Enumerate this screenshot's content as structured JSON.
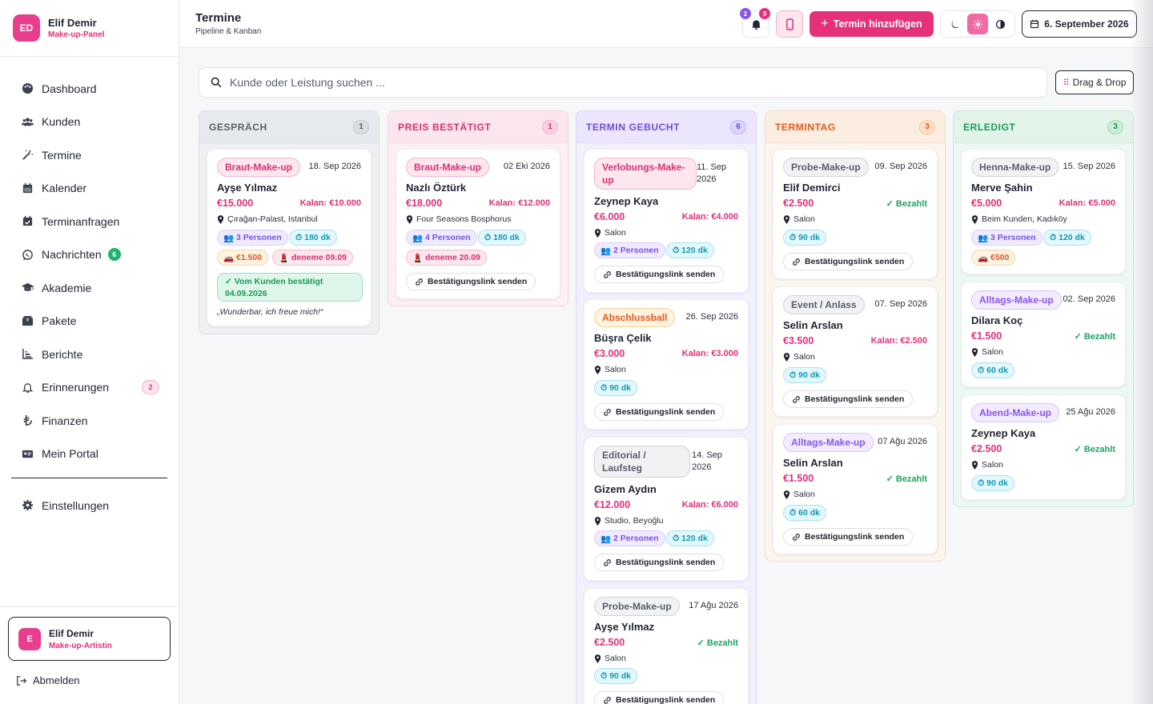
{
  "brand": {
    "initials": "ED",
    "name": "Elif Demir",
    "role": "Make-up-Panel"
  },
  "nav": [
    {
      "label": "Dashboard",
      "icon": "palette-icon"
    },
    {
      "label": "Kunden",
      "icon": "users-icon"
    },
    {
      "label": "Termine",
      "icon": "wand-icon"
    },
    {
      "label": "Kalender",
      "icon": "calendar-icon"
    },
    {
      "label": "Terminanfragen",
      "icon": "calendar-check-icon"
    },
    {
      "label": "Nachrichten",
      "icon": "whatsapp-icon",
      "badge": "6"
    },
    {
      "label": "Akademie",
      "icon": "graduation-cap-icon"
    },
    {
      "label": "Pakete",
      "icon": "box-icon"
    },
    {
      "label": "Berichte",
      "icon": "chart-icon"
    },
    {
      "label": "Erinnerungen",
      "icon": "bell-icon",
      "badge": "2"
    },
    {
      "label": "Finanzen",
      "icon": "lira-icon"
    },
    {
      "label": "Mein Portal",
      "icon": "id-card-icon"
    }
  ],
  "settings_label": "Einstellungen",
  "user": {
    "initial": "E",
    "name": "Elif Demir",
    "role": "Make-up-Artistin"
  },
  "logout_label": "Abmelden",
  "header": {
    "title": "Termine",
    "subtitle": "Pipeline & Kanban",
    "notif_badge_a": "2",
    "notif_badge_b": "9",
    "add_label": "Termin hinzufügen",
    "date_label": "6. September 2026"
  },
  "search": {
    "placeholder": "Kunde oder Leistung suchen ..."
  },
  "drag_label": "Drag & Drop",
  "columns": [
    {
      "title": "GESPRÄCH",
      "count": "1",
      "color": "#5a606c"
    },
    {
      "title": "PREIS BESTÄTIGT",
      "count": "1",
      "color": "#d8306f"
    },
    {
      "title": "TERMIN GEBUCHT",
      "count": "6",
      "color": "#6f4bd6"
    },
    {
      "title": "TERMINTAG",
      "count": "3",
      "color": "#e05a1e"
    },
    {
      "title": "ERLEDIGT",
      "count": "3",
      "color": "#1a9a58"
    }
  ],
  "cards": {
    "c1": {
      "tag": "Braut-Make-up",
      "date": "18. Sep 2026",
      "name": "Ayşe Yılmaz",
      "price": "€15.000",
      "kalan": "Kalan: €10.000",
      "loc": "Çırağan-Palast, Istanbul",
      "persons": "3 Personen",
      "time": "180 dk",
      "car": "€1.500",
      "lip": "deneme 09.09",
      "confirm": "✓ Vom Kunden bestätigt 04.09.2026",
      "quote": "„Wunderbar, ich freue mich!“"
    },
    "c2": {
      "tag": "Braut-Make-up",
      "date": "02 Eki 2026",
      "name": "Nazlı Öztürk",
      "price": "€18.000",
      "kalan": "Kalan: €12.000",
      "loc": "Four Seasons Bosphorus",
      "persons": "4 Personen",
      "time": "180 dk",
      "lip": "deneme 20.09",
      "link": "Bestätigungslink senden"
    },
    "c3": {
      "tag": "Verlobungs-Make-up",
      "date": "11. Sep 2026",
      "name": "Zeynep Kaya",
      "price": "€6.000",
      "kalan": "Kalan: €4.000",
      "loc": "Salon",
      "persons": "2 Personen",
      "time": "120 dk",
      "link": "Bestätigungslink senden"
    },
    "c4": {
      "tag": "Abschlussball",
      "date": "26. Sep 2026",
      "name": "Büşra Çelik",
      "price": "€3.000",
      "kalan": "Kalan: €3.000",
      "loc": "Salon",
      "time": "90 dk",
      "link": "Bestätigungslink senden"
    },
    "c5": {
      "tag": "Editorial / Laufsteg",
      "date": "14. Sep 2026",
      "name": "Gizem Aydın",
      "price": "€12.000",
      "kalan": "Kalan: €6.000",
      "loc": "Studio, Beyoğlu",
      "persons": "2 Personen",
      "time": "120 dk",
      "link": "Bestätigungslink senden"
    },
    "c6": {
      "tag": "Probe-Make-up",
      "date": "17 Ağu 2026",
      "name": "Ayşe Yılmaz",
      "price": "€2.500",
      "paid": "Bezahlt",
      "loc": "Salon",
      "time": "90 dk",
      "link": "Bestätigungslink senden"
    },
    "c7": {
      "tag": "Probe-Make-up",
      "date": "09. Sep 2026",
      "name": "Elif Demirci",
      "price": "€2.500",
      "paid": "Bezahlt",
      "loc": "Salon",
      "time": "90 dk",
      "link": "Bestätigungslink senden"
    },
    "c8": {
      "tag": "Event / Anlass",
      "date": "07. Sep 2026",
      "name": "Selin Arslan",
      "price": "€3.500",
      "kalan": "Kalan: €2.500",
      "loc": "Salon",
      "time": "90 dk",
      "link": "Bestätigungslink senden"
    },
    "c9": {
      "tag": "Alltags-Make-up",
      "date": "07 Ağu 2026",
      "name": "Selin Arslan",
      "price": "€1.500",
      "paid": "Bezahlt",
      "loc": "Salon",
      "time": "60 dk",
      "link": "Bestätigungslink senden"
    },
    "c10": {
      "tag": "Henna-Make-up",
      "date": "15. Sep 2026",
      "name": "Merve Şahin",
      "price": "€5.000",
      "kalan": "Kalan: €5.000",
      "loc": "Beim Kunden, Kadıköy",
      "persons": "3 Personen",
      "time": "120 dk",
      "car": "€500"
    },
    "c11": {
      "tag": "Alltags-Make-up",
      "date": "02. Sep 2026",
      "name": "Dilara Koç",
      "price": "€1.500",
      "paid": "Bezahlt",
      "loc": "Salon",
      "time": "60 dk"
    },
    "c12": {
      "tag": "Abend-Make-up",
      "date": "25 Ağu 2026",
      "name": "Zeynep Kaya",
      "price": "€2.500",
      "paid": "Bezahlt",
      "loc": "Salon",
      "time": "90 dk"
    }
  }
}
